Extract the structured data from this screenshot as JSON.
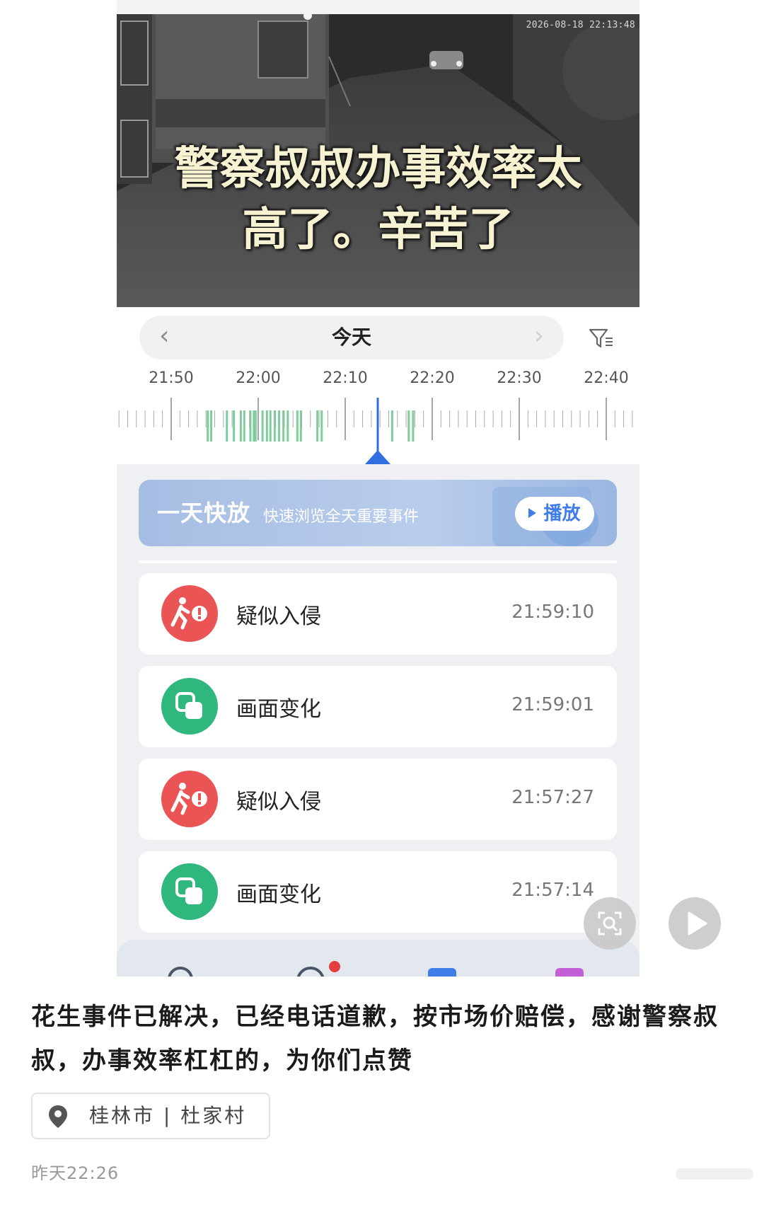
{
  "video": {
    "timestamp": "2026-08-18  22:13:48",
    "caption_line1": "警察叔叔办事效率太",
    "caption_line2": "高了。辛苦了"
  },
  "date_bar": {
    "date_label": "今天",
    "prev_icon": "chevron-left-icon",
    "next_icon": "chevron-right-icon",
    "filter_icon": "filter-icon"
  },
  "timeline": {
    "labels": [
      "21:50",
      "22:00",
      "22:10",
      "22:20",
      "22:30",
      "22:40"
    ],
    "cursor_time": "22:13",
    "event_color": "#7ccf9a",
    "cursor_color": "#2f6fe0"
  },
  "banner": {
    "title": "一天快放",
    "subtitle": "快速浏览全天重要事件",
    "play_label": "播放"
  },
  "events": [
    {
      "label": "疑似入侵",
      "time": "21:59:10",
      "type": "intrusion",
      "icon": "walking-person-alert-icon",
      "color": "#ea5455"
    },
    {
      "label": "画面变化",
      "time": "21:59:01",
      "type": "change",
      "icon": "overlapping-squares-icon",
      "color": "#2fb77d"
    },
    {
      "label": "疑似入侵",
      "time": "21:57:27",
      "type": "intrusion",
      "icon": "walking-person-alert-icon",
      "color": "#ea5455"
    },
    {
      "label": "画面变化",
      "time": "21:57:14",
      "type": "change",
      "icon": "overlapping-squares-icon",
      "color": "#2fb77d"
    }
  ],
  "floating_buttons": {
    "scan_icon": "screenshot-scan-icon",
    "play_icon": "play-icon"
  },
  "post": {
    "text": "花生事件已解决，已经电话道歉，按市场价赔偿，感谢警察叔叔，办事效率杠杠的，为你们点赞",
    "location": "桂林市 | 杜家村",
    "location_icon": "location-pin-icon",
    "time": "昨天22:26"
  }
}
